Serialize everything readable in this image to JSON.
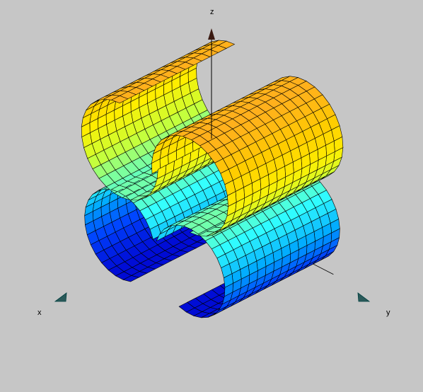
{
  "axes": {
    "x_label": "x",
    "y_label": "y",
    "z_label": "z",
    "axis_color": "#000000",
    "arrow_color": "#3a1a12"
  },
  "surface": {
    "cylinders": 4,
    "colormap": [
      "#0000cc",
      "#0044ff",
      "#00aaff",
      "#33ffff",
      "#ccff33",
      "#ffee00",
      "#ffcc00",
      "#ffaa22"
    ],
    "grid_color": "#000000"
  },
  "background_color": "#c6c6c6"
}
